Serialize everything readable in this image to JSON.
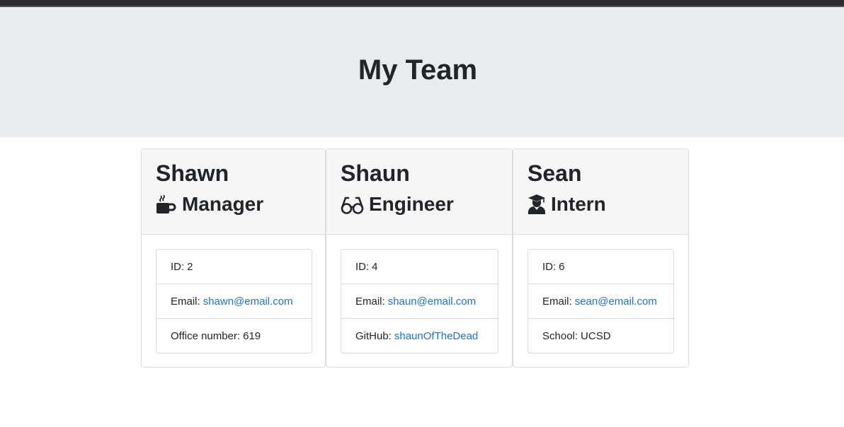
{
  "page": {
    "title": "My Team"
  },
  "team": [
    {
      "name": "Shawn",
      "role": "Manager",
      "icon": "coffee-icon",
      "id_label": "ID:",
      "id": "2",
      "email_label": "Email:",
      "email": "shawn@email.com",
      "extra_label": "Office number:",
      "extra": "619"
    },
    {
      "name": "Shaun",
      "role": "Engineer",
      "icon": "glasses-icon",
      "id_label": "ID:",
      "id": "4",
      "email_label": "Email:",
      "email": "shaun@email.com",
      "extra_label": "GitHub:",
      "extra": "shaunOfTheDead"
    },
    {
      "name": "Sean",
      "role": "Intern",
      "icon": "graduate-icon",
      "id_label": "ID:",
      "id": "6",
      "email_label": "Email:",
      "email": "sean@email.com",
      "extra_label": "School:",
      "extra": "UCSD"
    }
  ],
  "colors": {
    "header_bg": "#e9ecef",
    "card_header_bg": "#f6f6f6",
    "link": "#1a73d9",
    "text": "#212529"
  }
}
